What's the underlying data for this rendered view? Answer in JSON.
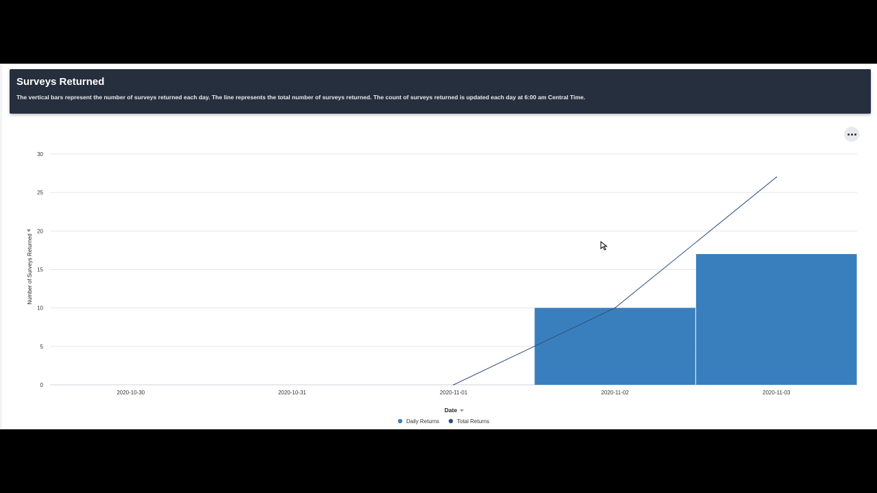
{
  "header": {
    "title": "Surveys Returned",
    "description": "The vertical bars represent the number of surveys returned each day. The line represents the total number of surveys returned. The count of surveys returned is updated each day at 6:00 am Central Time."
  },
  "menu": {
    "icon": "more-horizontal-icon"
  },
  "colors": {
    "bar": "#3a7fbd",
    "line": "#2d4f7c",
    "header_bg": "#262f3d",
    "grid": "#e4e6ea"
  },
  "chart_data": {
    "type": "bar",
    "categories": [
      "2020-10-30",
      "2020-10-31",
      "2020-11-01",
      "2020-11-02",
      "2020-11-03"
    ],
    "series": [
      {
        "name": "Daily Returns",
        "type": "bar",
        "values": [
          0,
          0,
          0,
          10,
          17
        ]
      },
      {
        "name": "Total Returns",
        "type": "line",
        "values": [
          null,
          null,
          0,
          10,
          27
        ]
      }
    ],
    "ylabel": "Number of Surveys Returned",
    "xlabel": "Date",
    "y_ticks": [
      0,
      5,
      10,
      15,
      20,
      25,
      30
    ],
    "ylim": [
      0,
      30
    ],
    "grid": true,
    "legend_position": "bottom-center"
  }
}
